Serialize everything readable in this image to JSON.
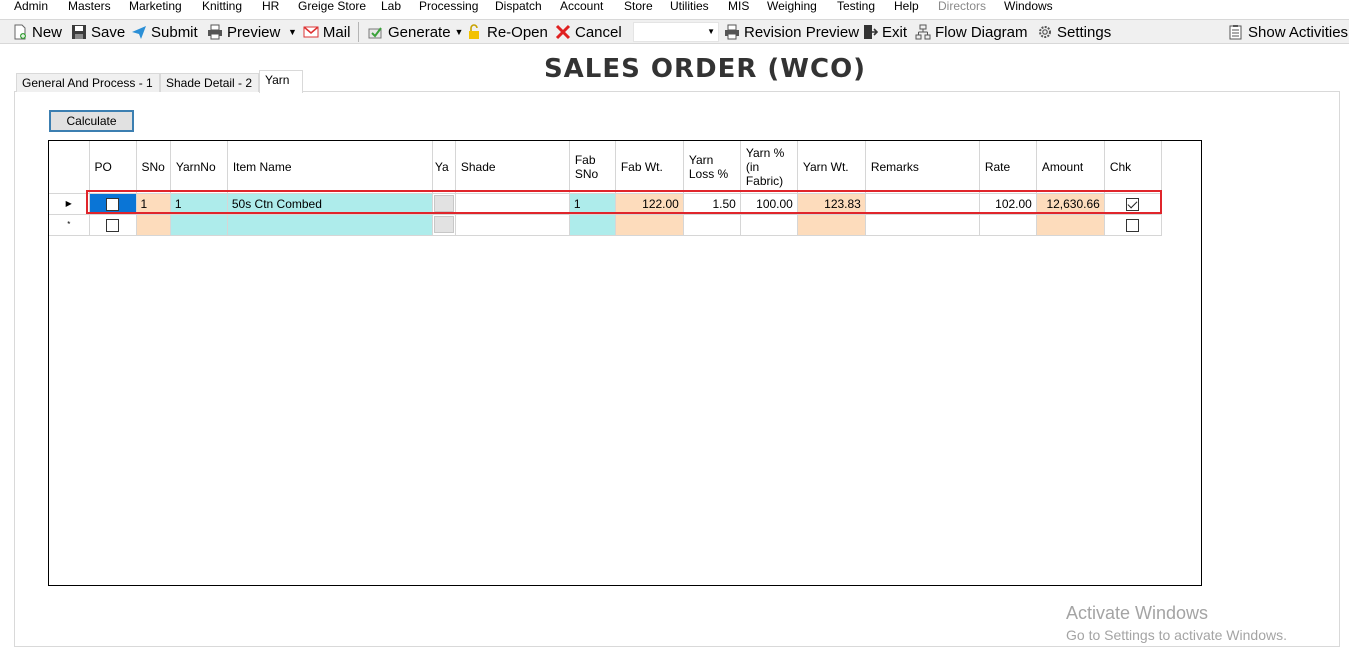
{
  "menubar": {
    "items": [
      {
        "label": "Admin",
        "disabled": false
      },
      {
        "label": "Masters",
        "disabled": false
      },
      {
        "label": "Marketing",
        "disabled": false
      },
      {
        "label": "Knitting",
        "disabled": false
      },
      {
        "label": "HR",
        "disabled": false
      },
      {
        "label": "Greige Store",
        "disabled": false
      },
      {
        "label": "Lab",
        "disabled": false
      },
      {
        "label": "Processing",
        "disabled": false
      },
      {
        "label": "Dispatch",
        "disabled": false
      },
      {
        "label": "Account",
        "disabled": false
      },
      {
        "label": "Store",
        "disabled": false
      },
      {
        "label": "Utilities",
        "disabled": false
      },
      {
        "label": "MIS",
        "disabled": false
      },
      {
        "label": "Weighing",
        "disabled": false
      },
      {
        "label": "Testing",
        "disabled": false
      },
      {
        "label": "Help",
        "disabled": false
      },
      {
        "label": "Directors",
        "disabled": true
      },
      {
        "label": "Windows",
        "disabled": false
      }
    ]
  },
  "toolbar": {
    "new": "New",
    "save": "Save",
    "submit": "Submit",
    "preview": "Preview",
    "mail": "Mail",
    "generate": "Generate",
    "reopen": "Re-Open",
    "cancel": "Cancel",
    "combo_value": "",
    "revision_preview": "Revision Preview",
    "exit": "Exit",
    "flow_diagram": "Flow Diagram",
    "settings": "Settings",
    "show_activities": "Show Activities"
  },
  "tabs": [
    {
      "label": "General And Process - 1",
      "active": false
    },
    {
      "label": "Shade Detail - 2",
      "active": false
    },
    {
      "label": "Yarn",
      "active": true
    }
  ],
  "page_title": "SALES ORDER (WCO)",
  "calculate_label": "Calculate",
  "grid": {
    "columns": [
      {
        "key": "po",
        "label": "PO"
      },
      {
        "key": "sno",
        "label": "SNo"
      },
      {
        "key": "yarnno",
        "label": "YarnNo"
      },
      {
        "key": "item_name",
        "label": "Item Name"
      },
      {
        "key": "ya",
        "label": "Ya"
      },
      {
        "key": "shade",
        "label": "Shade"
      },
      {
        "key": "fab_sno",
        "label": "Fab SNo"
      },
      {
        "key": "fab_wt",
        "label": "Fab Wt."
      },
      {
        "key": "yarn_loss",
        "label": "Yarn Loss %"
      },
      {
        "key": "yarn_pct",
        "label": "Yarn % (in Fabric)"
      },
      {
        "key": "yarn_wt",
        "label": "Yarn Wt."
      },
      {
        "key": "remarks",
        "label": "Remarks"
      },
      {
        "key": "rate",
        "label": "Rate"
      },
      {
        "key": "amount",
        "label": "Amount"
      },
      {
        "key": "chk",
        "label": "Chk"
      }
    ],
    "rows": [
      {
        "indicator": "▶",
        "po": false,
        "sno": "1",
        "yarnno": "1",
        "item_name": "50s Ctn Combed",
        "shade": "",
        "fab_sno": "1",
        "fab_wt": "122.00",
        "yarn_loss": "1.50",
        "yarn_pct": "100.00",
        "yarn_wt": "123.83",
        "remarks": "",
        "rate": "102.00",
        "amount": "12,630.66",
        "chk": true
      },
      {
        "indicator": "*",
        "po": false,
        "sno": "",
        "yarnno": "",
        "item_name": "",
        "shade": "",
        "fab_sno": "",
        "fab_wt": "",
        "yarn_loss": "",
        "yarn_pct": "",
        "yarn_wt": "",
        "remarks": "",
        "rate": "",
        "amount": "",
        "chk": false
      }
    ]
  },
  "watermark": {
    "line1": "Activate Windows",
    "line2": "Go to Settings to activate Windows."
  },
  "colors": {
    "aqua_cell": "#aeeceb",
    "peach_cell": "#fddcbc",
    "selected_cell": "#0a75d6",
    "highlight_border": "#e0252b"
  }
}
